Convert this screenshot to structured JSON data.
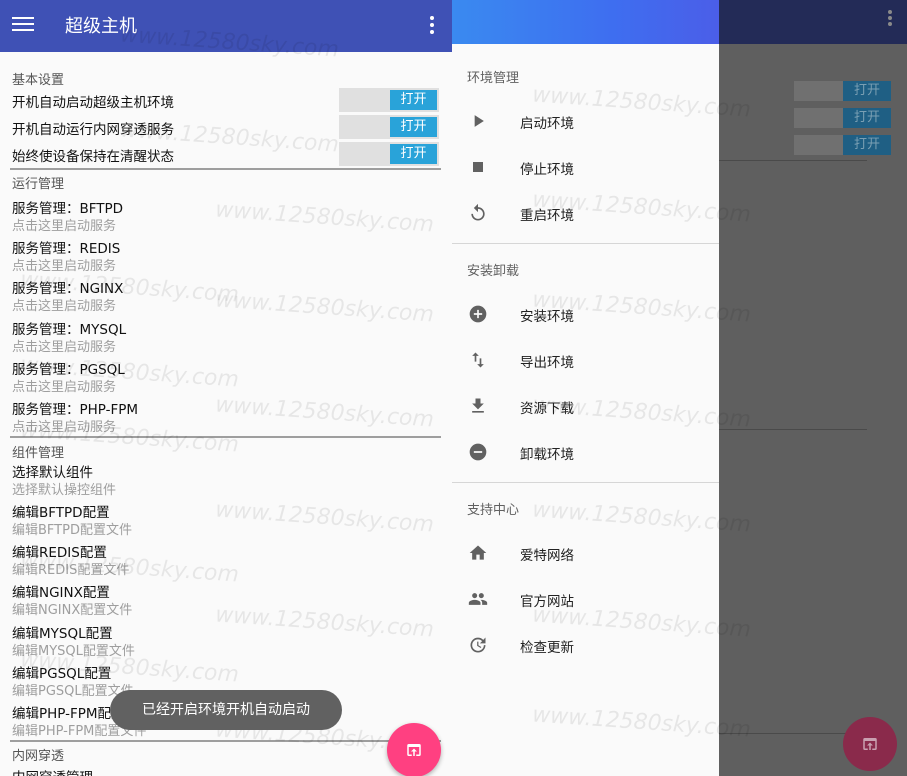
{
  "appbar": {
    "title": "超级主机"
  },
  "basic": {
    "header": "基本设置",
    "items": [
      {
        "label": "开机自动启动超级主机环境",
        "switch": "打开"
      },
      {
        "label": "开机自动运行内网穿透服务",
        "switch": "打开"
      },
      {
        "label": "始终使设备保持在清醒状态",
        "switch": "打开"
      }
    ]
  },
  "run": {
    "header": "运行管理",
    "items": [
      {
        "title": "服务管理：BFTPD",
        "sub": "点击这里启动服务"
      },
      {
        "title": "服务管理：REDIS",
        "sub": "点击这里启动服务"
      },
      {
        "title": "服务管理：NGINX",
        "sub": "点击这里启动服务"
      },
      {
        "title": "服务管理：MYSQL",
        "sub": "点击这里启动服务"
      },
      {
        "title": "服务管理：PGSQL",
        "sub": "点击这里启动服务"
      },
      {
        "title": "服务管理：PHP-FPM",
        "sub": "点击这里启动服务"
      }
    ]
  },
  "components": {
    "header": "组件管理",
    "items": [
      {
        "title": "选择默认组件",
        "sub": "选择默认操控组件"
      },
      {
        "title": "编辑BFTPD配置",
        "sub": "编辑BFTPD配置文件"
      },
      {
        "title": "编辑REDIS配置",
        "sub": "编辑REDIS配置文件"
      },
      {
        "title": "编辑NGINX配置",
        "sub": "编辑NGINX配置文件"
      },
      {
        "title": "编辑MYSQL配置",
        "sub": "编辑MYSQL配置文件"
      },
      {
        "title": "编辑PGSQL配置",
        "sub": "编辑PGSQL配置文件"
      },
      {
        "title": "编辑PHP-FPM配置",
        "sub": "编辑PHP-FPM配置文件"
      }
    ]
  },
  "tunnel": {
    "header": "内网穿透",
    "first_item": "内网穿透管理"
  },
  "toast": "已经开启环境开机自动启动",
  "background_switch_label": "打开",
  "drawer": {
    "sections": [
      {
        "header": "环境管理",
        "items": [
          {
            "icon": "play-icon",
            "label": "启动环境"
          },
          {
            "icon": "stop-icon",
            "label": "停止环境"
          },
          {
            "icon": "restart-icon",
            "label": "重启环境"
          }
        ]
      },
      {
        "header": "安装卸载",
        "items": [
          {
            "icon": "add-circle-icon",
            "label": "安装环境"
          },
          {
            "icon": "swap-vertical-icon",
            "label": "导出环境"
          },
          {
            "icon": "download-icon",
            "label": "资源下载"
          },
          {
            "icon": "remove-circle-icon",
            "label": "卸载环境"
          }
        ]
      },
      {
        "header": "支持中心",
        "items": [
          {
            "icon": "home-icon",
            "label": "爱特网络"
          },
          {
            "icon": "people-icon",
            "label": "官方网站"
          },
          {
            "icon": "update-icon",
            "label": "检查更新"
          }
        ]
      }
    ]
  },
  "watermark": "www.12580sky.com",
  "colors": {
    "appbar": "#3f51b5",
    "switch_on": "#29a3d9",
    "fab": "#ff4081",
    "toast": "#616161"
  }
}
